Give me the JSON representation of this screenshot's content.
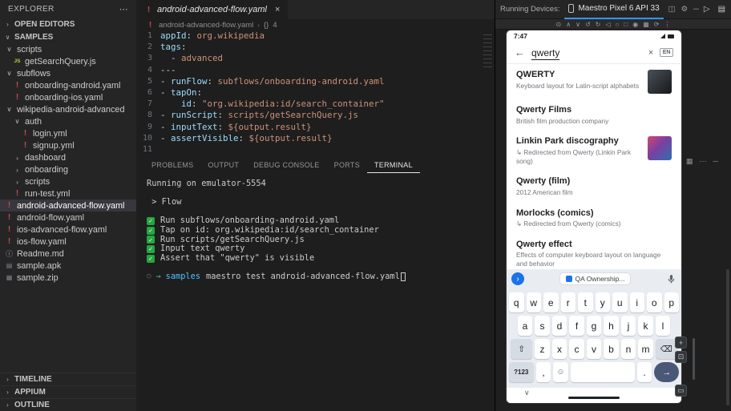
{
  "explorer": {
    "title": "EXPLORER",
    "sections": {
      "open_editors": "OPEN EDITORS",
      "samples": "SAMPLES",
      "timeline": "TIMELINE",
      "appium": "APPIUM",
      "outline": "OUTLINE"
    },
    "tree": [
      {
        "label": "scripts",
        "icon": "chevron-down-icon",
        "indent": 0
      },
      {
        "label": "getSearchQuery.js",
        "icon": "js-icon",
        "indent": 1
      },
      {
        "label": "subflows",
        "icon": "chevron-down-icon",
        "indent": 0
      },
      {
        "label": "onboarding-android.yaml",
        "icon": "yaml-icon",
        "indent": 1
      },
      {
        "label": "onboarding-ios.yaml",
        "icon": "yaml-icon",
        "indent": 1
      },
      {
        "label": "wikipedia-android-advanced",
        "icon": "chevron-down-icon",
        "indent": 0
      },
      {
        "label": "auth",
        "icon": "chevron-down-icon",
        "indent": 1
      },
      {
        "label": "login.yml",
        "icon": "yaml-icon",
        "indent": 2
      },
      {
        "label": "signup.yml",
        "icon": "yaml-icon",
        "indent": 2
      },
      {
        "label": "dashboard",
        "icon": "chevron-right-icon",
        "indent": 1
      },
      {
        "label": "onboarding",
        "icon": "chevron-right-icon",
        "indent": 1
      },
      {
        "label": "scripts",
        "icon": "chevron-right-icon",
        "indent": 1
      },
      {
        "label": "run-test.yml",
        "icon": "yaml-icon",
        "indent": 1
      },
      {
        "label": "android-advanced-flow.yaml",
        "icon": "yaml-icon",
        "indent": 0,
        "selected": true
      },
      {
        "label": "android-flow.yaml",
        "icon": "yaml-icon",
        "indent": 0
      },
      {
        "label": "ios-advanced-flow.yaml",
        "icon": "yaml-icon",
        "indent": 0
      },
      {
        "label": "ios-flow.yaml",
        "icon": "yaml-icon",
        "indent": 0
      },
      {
        "label": "Readme.md",
        "icon": "markdown-icon",
        "indent": 0
      },
      {
        "label": "sample.apk",
        "icon": "file-icon",
        "indent": 0
      },
      {
        "label": "sample.zip",
        "icon": "archive-icon",
        "indent": 0
      }
    ]
  },
  "editor": {
    "tab": {
      "label": "android-advanced-flow.yaml"
    },
    "breadcrumb": {
      "file": "android-advanced-flow.yaml",
      "symbol": "{}",
      "count": "4"
    },
    "lines": [
      {
        "n": "1",
        "tokens": [
          [
            "k",
            "appId"
          ],
          [
            "p",
            ":"
          ],
          [
            "s",
            " org.wikipedia"
          ]
        ]
      },
      {
        "n": "2",
        "tokens": [
          [
            "k",
            "tags"
          ],
          [
            "p",
            ":"
          ]
        ]
      },
      {
        "n": "3",
        "tokens": [
          [
            "p",
            "  - "
          ],
          [
            "s",
            "advanced"
          ]
        ]
      },
      {
        "n": "4",
        "tokens": [
          [
            "p",
            "---"
          ]
        ]
      },
      {
        "n": "5",
        "tokens": [
          [
            "p",
            "- "
          ],
          [
            "k",
            "runFlow"
          ],
          [
            "p",
            ":"
          ],
          [
            "s",
            " subflows/onboarding-android.yaml"
          ]
        ]
      },
      {
        "n": "6",
        "tokens": [
          [
            "p",
            "- "
          ],
          [
            "k",
            "tapOn"
          ],
          [
            "p",
            ":"
          ]
        ]
      },
      {
        "n": "7",
        "tokens": [
          [
            "p",
            "    "
          ],
          [
            "k",
            "id"
          ],
          [
            "p",
            ":"
          ],
          [
            "s",
            " \"org.wikipedia:id/search_container\""
          ]
        ]
      },
      {
        "n": "8",
        "tokens": [
          [
            "p",
            "- "
          ],
          [
            "k",
            "runScript"
          ],
          [
            "p",
            ":"
          ],
          [
            "s",
            " scripts/getSearchQuery.js"
          ]
        ]
      },
      {
        "n": "9",
        "tokens": [
          [
            "p",
            "- "
          ],
          [
            "k",
            "inputText"
          ],
          [
            "p",
            ":"
          ],
          [
            "s",
            " ${output.result}"
          ]
        ]
      },
      {
        "n": "10",
        "tokens": [
          [
            "p",
            "- "
          ],
          [
            "k",
            "assertVisible"
          ],
          [
            "p",
            ":"
          ],
          [
            "s",
            " ${output.result}"
          ]
        ]
      },
      {
        "n": "11",
        "tokens": []
      }
    ]
  },
  "panel": {
    "tabs": [
      {
        "label": "PROBLEMS"
      },
      {
        "label": "OUTPUT"
      },
      {
        "label": "DEBUG CONSOLE"
      },
      {
        "label": "PORTS"
      },
      {
        "label": "TERMINAL",
        "active": true
      }
    ],
    "terminal": {
      "lines": [
        {
          "type": "text",
          "text": "Running on emulator-5554"
        },
        {
          "type": "blank"
        },
        {
          "type": "text",
          "text": " > Flow"
        },
        {
          "type": "blank"
        },
        {
          "type": "check",
          "text": "Run subflows/onboarding-android.yaml"
        },
        {
          "type": "check",
          "text": "Tap on id: org.wikipedia:id/search_container"
        },
        {
          "type": "check",
          "text": "Run scripts/getSearchQuery.js"
        },
        {
          "type": "check",
          "text": "Input text qwerty"
        },
        {
          "type": "check",
          "text": "Assert that \"qwerty\" is visible"
        },
        {
          "type": "blank"
        },
        {
          "type": "prompt",
          "dir": "samples",
          "command": "maestro test android-advanced-flow.yaml"
        }
      ]
    }
  },
  "devices": {
    "header_label": "Running Devices:",
    "tab_label": "Maestro Pixel 6 API 33",
    "header_icons": [
      "split-icon",
      "gear-icon",
      "minimize-icon"
    ],
    "corner_icons": [
      "run-icon",
      "layout-icon"
    ],
    "toolbar_icons": [
      "power-icon",
      "volume-up-icon",
      "volume-down-icon",
      "rotate-left-icon",
      "rotate-right-icon",
      "back-icon",
      "home-icon",
      "overview-icon",
      "screenshot-icon",
      "record-icon",
      "snapshot-icon",
      "more-vertical-icon"
    ],
    "side_icons": [
      "grid-icon",
      "ellipsis-icon",
      "dash-icon"
    ],
    "zoom_icons": [
      "zoom-in-icon",
      "zoom-fit-icon",
      "hardware-input-icon"
    ],
    "phone": {
      "status_time": "7:47",
      "search": {
        "query": "qwerty",
        "lang_badge": "EN"
      },
      "results": [
        {
          "title": "QWERTY",
          "subtitle": "Keyboard layout for Latin-script alphabets",
          "thumb": "dark"
        },
        {
          "title": "Qwerty Films",
          "subtitle": "British film production company"
        },
        {
          "title": "Linkin Park discography",
          "subtitle": "↳ Redirected from Qwerty (Linkin Park song)",
          "thumb": "color"
        },
        {
          "title": "Qwerty (film)",
          "subtitle": "2012 American film"
        },
        {
          "title": "Morlocks (comics)",
          "subtitle": "↳ Redirected from Qwerty (comics)"
        },
        {
          "title": "Qwerty effect",
          "subtitle": "Effects of computer keyboard layout on language and behavior"
        }
      ],
      "suggestion_chip": "QA Ownership...",
      "keyboard": {
        "row1": [
          "q",
          "w",
          "e",
          "r",
          "t",
          "y",
          "u",
          "i",
          "o",
          "p"
        ],
        "row2": [
          "a",
          "s",
          "d",
          "f",
          "g",
          "h",
          "j",
          "k",
          "l"
        ],
        "row3": [
          "z",
          "x",
          "c",
          "v",
          "b",
          "n",
          "m"
        ],
        "symbols_key": "?123",
        "comma_key": ",",
        "period_key": "."
      }
    }
  }
}
